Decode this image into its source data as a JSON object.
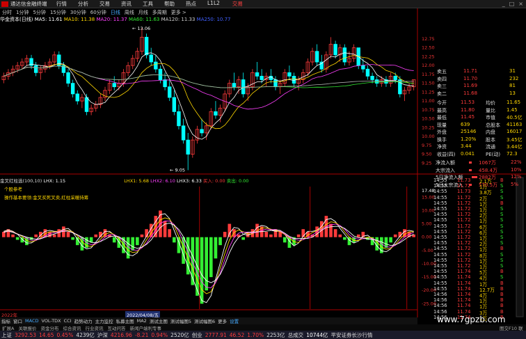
{
  "app": {
    "title": "通达信金融终端",
    "menu": [
      "行情",
      "分析",
      "交易",
      "资讯",
      "工具",
      "帮助",
      "热点",
      "L1L2"
    ],
    "trade_label": "交易",
    "winbtns": [
      "_",
      "□",
      "×"
    ]
  },
  "toolbar": {
    "items": [
      "分时",
      "1分钟",
      "5分钟",
      "15分钟",
      "30分钟",
      "60分钟",
      "日线",
      "周线",
      "月线",
      "多周期",
      "更多 >"
    ],
    "selected": "日线"
  },
  "stock": {
    "name": "华金资本(日线)",
    "ma5": "MA5: 11.61",
    "ma10": "MA10: 11.38",
    "ma20": "MA20: 11.37",
    "ma60": "MA60: 11.63",
    "ma120": "MA120: 11.33",
    "extra": "MA250: 10.77"
  },
  "chart_data": {
    "type": "candlestick",
    "price_axis": [
      "12.75",
      "12.50",
      "12.25",
      "12.00",
      "11.75",
      "11.50",
      "11.25",
      "11.00",
      "10.75",
      "10.50",
      "10.25",
      "10.00",
      "9.75",
      "9.50",
      "9.25"
    ],
    "candles": [
      [
        11.6,
        11.8,
        11.5,
        11.7
      ],
      [
        11.7,
        11.9,
        11.6,
        11.8
      ],
      [
        11.8,
        12.0,
        11.7,
        11.9
      ],
      [
        11.9,
        12.1,
        11.8,
        12.0
      ],
      [
        12.0,
        12.2,
        11.9,
        12.1
      ],
      [
        12.1,
        12.3,
        12.0,
        12.2
      ],
      [
        12.2,
        12.3,
        11.9,
        12.0
      ],
      [
        12.0,
        12.1,
        11.7,
        11.8
      ],
      [
        11.8,
        12.0,
        11.6,
        11.9
      ],
      [
        11.9,
        12.1,
        11.8,
        12.0
      ],
      [
        12.0,
        12.2,
        11.9,
        12.1
      ],
      [
        12.1,
        12.4,
        12.0,
        12.3
      ],
      [
        12.3,
        12.4,
        11.9,
        12.0
      ],
      [
        12.0,
        12.1,
        11.7,
        11.8
      ],
      [
        11.8,
        11.9,
        11.4,
        11.5
      ],
      [
        11.5,
        11.6,
        11.1,
        11.2
      ],
      [
        11.2,
        11.3,
        10.9,
        11.0
      ],
      [
        11.0,
        11.2,
        10.8,
        11.1
      ],
      [
        11.1,
        11.2,
        10.6,
        10.7
      ],
      [
        10.7,
        10.9,
        10.6,
        10.8
      ],
      [
        10.8,
        11.0,
        10.7,
        10.9
      ],
      [
        10.9,
        11.2,
        10.8,
        11.1
      ],
      [
        11.1,
        11.4,
        11.0,
        11.3
      ],
      [
        11.3,
        11.6,
        11.2,
        11.5
      ],
      [
        11.5,
        11.7,
        11.3,
        11.4
      ],
      [
        11.4,
        11.6,
        11.3,
        11.5
      ],
      [
        11.5,
        11.9,
        11.4,
        11.8
      ],
      [
        11.8,
        12.1,
        11.7,
        12.0
      ],
      [
        12.0,
        12.3,
        11.9,
        12.2
      ],
      [
        12.2,
        12.5,
        12.1,
        12.4
      ],
      [
        12.4,
        13.06,
        12.3,
        12.8
      ],
      [
        12.8,
        12.9,
        12.2,
        12.3
      ],
      [
        12.3,
        12.5,
        12.0,
        12.1
      ],
      [
        12.1,
        12.3,
        11.8,
        11.9
      ],
      [
        11.9,
        12.0,
        11.5,
        11.6
      ],
      [
        11.6,
        11.8,
        11.3,
        11.4
      ],
      [
        11.4,
        11.6,
        11.0,
        11.1
      ],
      [
        11.1,
        11.3,
        10.6,
        10.7
      ],
      [
        10.7,
        10.9,
        10.2,
        10.3
      ],
      [
        10.3,
        10.5,
        9.8,
        9.9
      ],
      [
        9.9,
        10.1,
        9.05,
        9.5
      ],
      [
        9.5,
        10.0,
        9.4,
        9.9
      ],
      [
        9.9,
        10.3,
        9.8,
        10.2
      ],
      [
        10.2,
        10.5,
        10.0,
        10.1
      ],
      [
        10.1,
        10.4,
        9.9,
        10.3
      ],
      [
        10.3,
        10.8,
        10.2,
        10.7
      ],
      [
        10.7,
        11.0,
        10.5,
        10.6
      ],
      [
        10.6,
        10.9,
        10.4,
        10.8
      ],
      [
        10.8,
        11.3,
        10.7,
        11.2
      ],
      [
        11.2,
        11.6,
        11.1,
        11.5
      ],
      [
        11.5,
        11.8,
        11.3,
        11.4
      ],
      [
        11.4,
        11.7,
        11.2,
        11.6
      ],
      [
        11.6,
        11.8,
        11.1,
        11.2
      ],
      [
        11.2,
        11.5,
        11.0,
        11.4
      ],
      [
        11.4,
        11.9,
        11.3,
        11.8
      ],
      [
        11.8,
        12.1,
        11.6,
        11.7
      ],
      [
        11.7,
        11.9,
        11.5,
        11.6
      ],
      [
        11.6,
        11.8,
        11.4,
        11.7
      ],
      [
        11.7,
        11.9,
        11.5,
        11.6
      ],
      [
        11.6,
        11.7,
        11.3,
        11.4
      ],
      [
        11.4,
        11.6,
        11.2,
        11.5
      ],
      [
        11.5,
        11.9,
        11.4,
        11.8
      ],
      [
        11.8,
        12.0,
        11.6,
        11.7
      ],
      [
        11.7,
        11.8,
        11.4,
        11.5
      ],
      [
        11.5,
        11.7,
        11.3,
        11.6
      ],
      [
        11.6,
        11.9,
        11.5,
        11.8
      ],
      [
        11.8,
        12.2,
        11.7,
        12.1
      ],
      [
        12.1,
        12.5,
        12.0,
        12.4
      ],
      [
        12.4,
        12.6,
        12.0,
        12.1
      ],
      [
        12.1,
        12.3,
        11.8,
        11.9
      ],
      [
        11.9,
        12.4,
        11.8,
        12.3
      ],
      [
        12.3,
        12.8,
        12.2,
        12.6
      ],
      [
        12.6,
        12.7,
        12.2,
        12.3
      ],
      [
        12.3,
        12.6,
        12.1,
        12.5
      ],
      [
        12.5,
        12.6,
        12.0,
        12.1
      ],
      [
        12.1,
        12.4,
        12.0,
        12.2
      ],
      [
        12.2,
        12.6,
        12.1,
        12.5
      ],
      [
        12.5,
        12.5,
        11.9,
        12.0
      ],
      [
        12.0,
        12.2,
        11.8,
        11.9
      ],
      [
        11.9,
        12.0,
        11.6,
        11.7
      ],
      [
        11.7,
        11.8,
        11.5,
        11.6
      ],
      [
        11.6,
        11.7,
        11.4,
        11.5
      ],
      [
        11.5,
        11.7,
        11.4,
        11.6
      ],
      [
        11.6,
        11.7,
        11.4,
        11.5
      ],
      [
        11.5,
        11.8,
        11.4,
        11.7
      ],
      [
        11.7,
        11.8,
        11.5,
        11.6
      ],
      [
        11.6,
        11.7,
        11.1,
        11.2
      ],
      [
        11.2,
        11.4,
        11.0,
        11.3
      ],
      [
        11.3,
        11.5,
        11.2,
        11.4
      ],
      [
        11.4,
        11.6,
        11.3,
        11.6
      ]
    ],
    "annotations": {
      "high": "13.06",
      "low": "9.05"
    },
    "osc_axis": [
      "17.48",
      "15.00",
      "10.00",
      "5.00",
      "0.00",
      "-5.00",
      "-10.00",
      "-15.00",
      "-20.00",
      "-25.00"
    ],
    "bars": [
      2,
      3,
      1,
      -1,
      -2,
      -3,
      -1,
      1,
      2,
      3,
      2,
      1,
      3,
      4,
      2,
      -1,
      -3,
      -5,
      -4,
      -2,
      1,
      2,
      3,
      1,
      -2,
      -4,
      -6,
      -8,
      -5,
      -3,
      1,
      3,
      5,
      8,
      10,
      6,
      3,
      -2,
      -6,
      -10,
      -14,
      -18,
      -22,
      -25,
      -20,
      -15,
      -8,
      -3,
      2,
      5,
      3,
      1,
      -1,
      2,
      3,
      5,
      4,
      2,
      1,
      3,
      2,
      -2,
      -4,
      -3,
      1,
      3,
      2,
      1,
      4,
      6,
      8,
      5,
      3,
      1,
      -1,
      -3,
      -2,
      1,
      2,
      -1,
      -3,
      -5,
      -6,
      -4,
      -2,
      1,
      2,
      3,
      2,
      1
    ],
    "title": "",
    "xlabel": "",
    "ylabel": ""
  },
  "osc": {
    "title": "金叉红柱选(100,10)",
    "lhx": "LHX: 1.15",
    "lhx1": "LHX1: 5.68",
    "lhx2": "LHX2: 6.10",
    "lhx3": "LHX3: 6.33",
    "buy": "买入: 0.00",
    "sell": "卖出: 0.00",
    "label1": "个股参考",
    "label2": "操作基本要领:金叉买死叉卖,红柱采暖持筹",
    "date": "2022/04/08/五",
    "date_left": "2022年"
  },
  "right": {
    "asks": [
      [
        "卖五",
        "11.71",
        "31"
      ],
      [
        "卖四",
        "11.70",
        "232"
      ],
      [
        "卖三",
        "11.69",
        "81"
      ],
      [
        "卖二",
        "11.68",
        "13"
      ]
    ],
    "rows": [
      [
        "今开",
        "11.53",
        "均价",
        "11.65"
      ],
      [
        "最高",
        "11.80",
        "量比",
        "1.45"
      ],
      [
        "最低",
        "11.45",
        "市值",
        "40.5亿"
      ],
      [
        "现量",
        "639",
        "总股本",
        "41163"
      ],
      [
        "外盘",
        "25146",
        "内盘",
        "16017"
      ],
      [
        "换手",
        "1.20%",
        "股本",
        "3.45亿"
      ],
      [
        "净资",
        "3.44",
        "流通",
        "3.44亿"
      ],
      [
        "收益(四)",
        "0.041",
        "PE(动)",
        "72.3"
      ]
    ],
    "flows": [
      [
        "净流入额",
        "1067万",
        "22%"
      ],
      [
        "大宗流入",
        "458.4万",
        "10%"
      ],
      [
        "5日净流入额",
        "2882万",
        "12%"
      ],
      [
        "5日大宗流入",
        "570.5万",
        "5%"
      ]
    ],
    "colors": {
      "up": "#ff3b3b",
      "down": "#3cb371",
      "neutral": "#e0e0e0",
      "yellow": "#ffd700",
      "cyan": "#00d0e0",
      "green": "#33ee33"
    }
  },
  "ticks": [
    [
      "14:55",
      "11.73",
      "2.1万",
      "B"
    ],
    [
      "14:55",
      "11.72",
      "1万",
      "S"
    ],
    [
      "14:55",
      "11.73",
      "3.8万",
      "S"
    ],
    [
      "14:55",
      "11.72",
      "2万",
      "S"
    ],
    [
      "14:55",
      "11.72",
      "1万",
      "B"
    ],
    [
      "14:55",
      "11.72",
      "1万",
      "S"
    ],
    [
      "14:55",
      "11.72",
      "2万",
      "S"
    ],
    [
      "14:55",
      "11.72",
      "1万",
      "S"
    ],
    [
      "14:55",
      "11.72",
      "6万",
      "S"
    ],
    [
      "14:55",
      "11.72",
      "6万",
      "S"
    ],
    [
      "14:55",
      "11.72",
      "1万",
      "S"
    ],
    [
      "14:55",
      "11.72",
      "2万",
      "S"
    ],
    [
      "14:55",
      "11.72",
      "1万",
      "B"
    ],
    [
      "14:55",
      "11.72",
      "8万",
      "S"
    ],
    [
      "14:55",
      "11.72",
      "1万",
      "S"
    ],
    [
      "14:55",
      "11.72",
      "1万",
      "S"
    ],
    [
      "14:55",
      "11.74",
      "5万",
      "B"
    ],
    [
      "14:55",
      "11.74",
      "4万",
      "S"
    ],
    [
      "14:55",
      "11.74",
      "1万",
      "B"
    ],
    [
      "14:55",
      "11.74",
      "12.7万",
      "B"
    ],
    [
      "14:56",
      "11.74",
      "4万",
      "B"
    ],
    [
      "14:56",
      "11.74",
      "1万",
      "B"
    ],
    [
      "14:56",
      "11.74",
      "1万",
      "B"
    ],
    [
      "14:56",
      "11.74",
      "3万",
      "B"
    ],
    [
      "14:56",
      "11.74",
      "1万",
      "B"
    ]
  ],
  "bottomtabs": [
    "指标",
    "窗口",
    "MACD",
    "VOL-TDX",
    "CCI",
    "趋势动力",
    "主力监控",
    "私募主图",
    "MA2",
    "测试主图",
    "测试幅图5",
    "测试幅图6",
    "更多",
    "设置"
  ],
  "bottomtabs2": [
    "扩展A",
    "关联报价",
    "资金分布",
    "综合资讯",
    "行业资讯",
    "互动问答",
    "新闻户端利专事"
  ],
  "status": {
    "sh_label": "上证",
    "sh_val": "3292.53",
    "sh_chg": "14.65",
    "sh_pct": "0.45%",
    "sh_vol": "4239亿",
    "sz_label": "沪深",
    "sz_val": "4216.96",
    "sz_chg": "-8.21",
    "sz_pct": "0.94%",
    "sz_vol": "2520亿",
    "cy_label": "创业",
    "cy_val": "2777.91",
    "cy_chg": "46.52",
    "cy_pct": "1.70%",
    "cy_vol": "2253亿",
    "total_label": "总成交",
    "total_val": "10744亿",
    "news": "平安证券长沙行情",
    "watermark": "www.7gpzb.com",
    "right_tab": "图交F10 联动"
  }
}
